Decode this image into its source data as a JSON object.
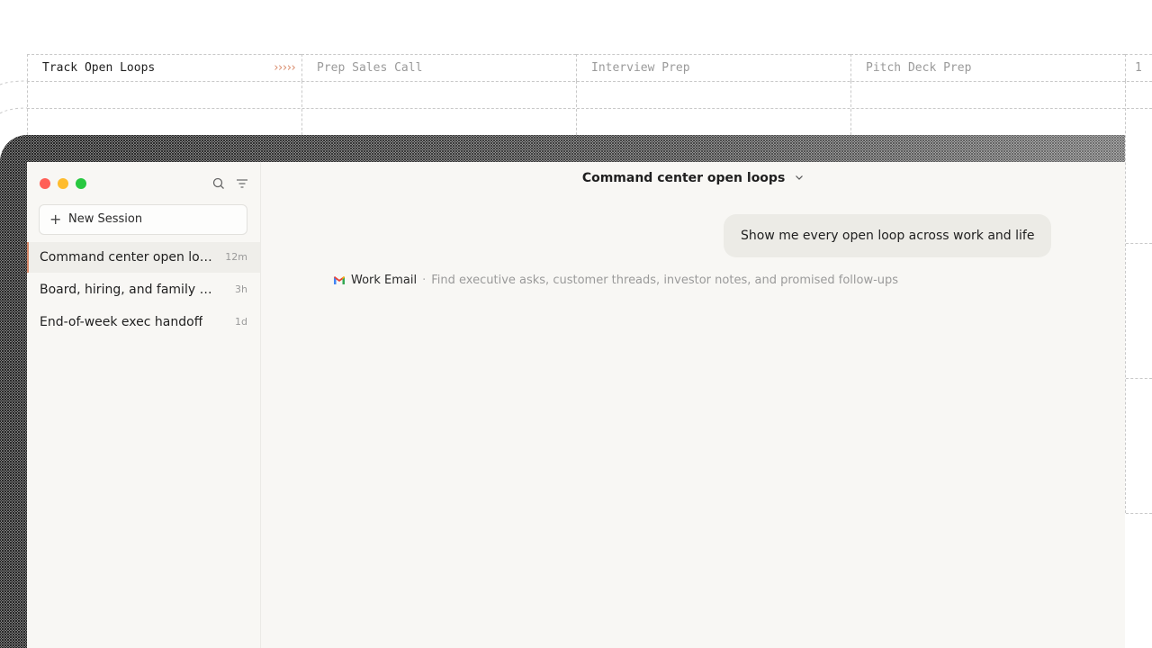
{
  "top_tabs": [
    {
      "label": "Track Open Loops",
      "active": true
    },
    {
      "label": "Prep Sales Call",
      "active": false
    },
    {
      "label": "Interview Prep",
      "active": false
    },
    {
      "label": "Pitch Deck Prep",
      "active": false
    },
    {
      "label": "1",
      "active": false
    }
  ],
  "sidebar": {
    "new_session_label": "New Session",
    "sessions": [
      {
        "title": "Command center open loops",
        "time": "12m",
        "active": true
      },
      {
        "title": "Board, hiring, and family schedule",
        "time": "3h",
        "active": false
      },
      {
        "title": "End-of-week exec handoff",
        "time": "1d",
        "active": false
      }
    ]
  },
  "main": {
    "title": "Command center open loops",
    "user_message": "Show me every open loop across work and life",
    "source": {
      "icon": "gmail-icon",
      "name": "Work Email",
      "separator": "·",
      "description": "Find executive asks, customer threads, investor notes, and promised follow-ups"
    }
  },
  "colors": {
    "accent": "#d98a6a",
    "traffic_red": "#ff5f57",
    "traffic_yellow": "#febc2e",
    "traffic_green": "#28c840"
  }
}
